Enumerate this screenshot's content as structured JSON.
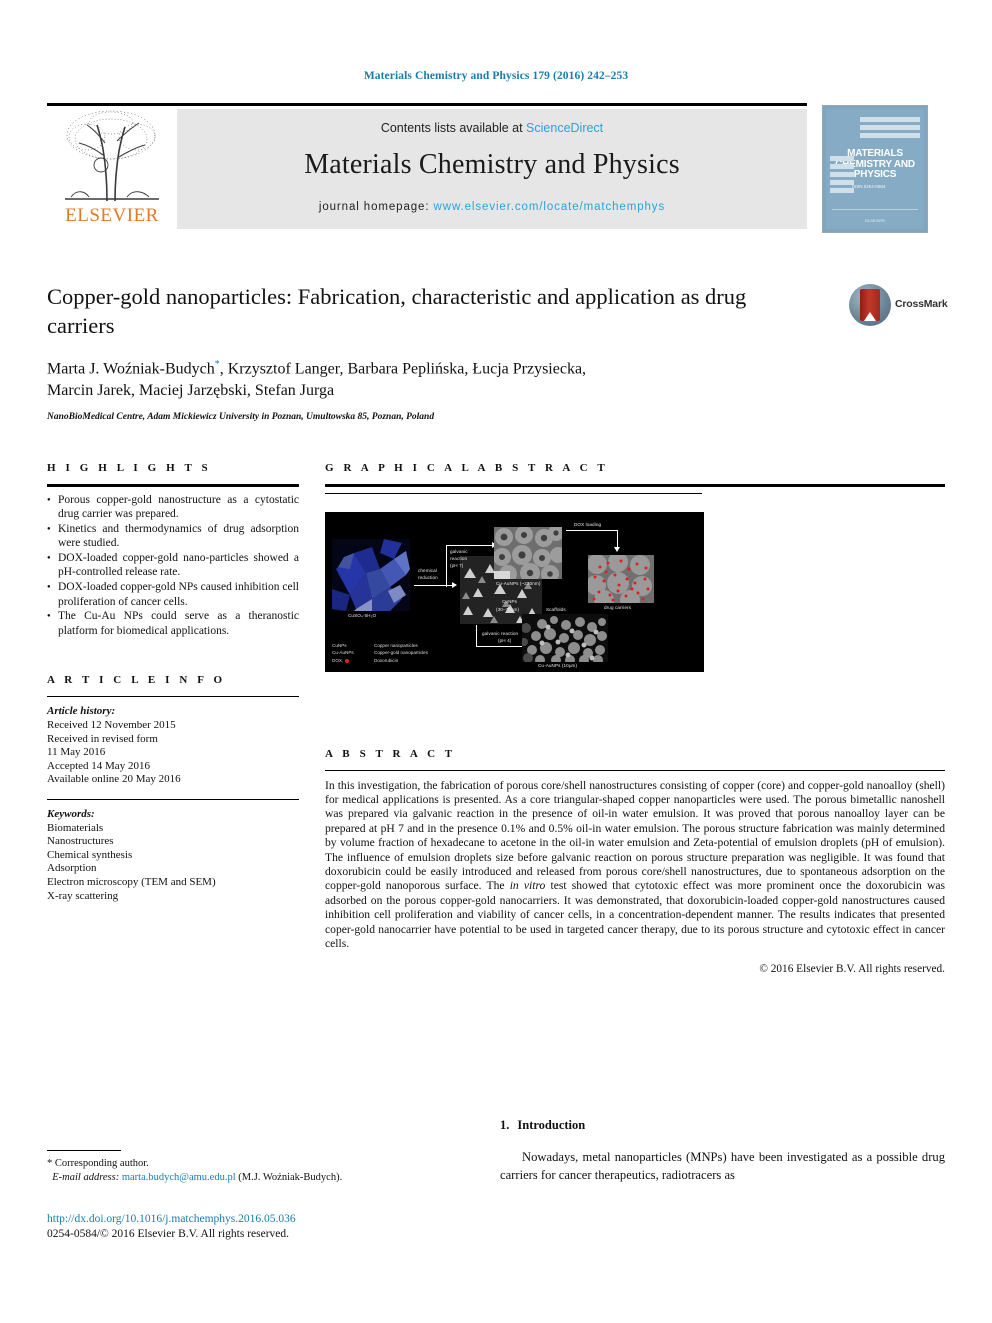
{
  "running_head": "Materials Chemistry and Physics 179 (2016) 242–253",
  "masthead": {
    "contents_prefix": "Contents lists available at ",
    "sciencedirect": "ScienceDirect",
    "journal_title": "Materials Chemistry and Physics",
    "homepage_prefix": "journal homepage: ",
    "homepage_url": "www.elsevier.com/locate/matchemphys",
    "publisher": "ELSEVIER",
    "publisher_color": "#e87722",
    "link_color": "#2aa3d6",
    "cover": {
      "title_line1": "MATERIALS",
      "title_line2": "CHEMISTRY AND",
      "title_line3": "PHYSICS",
      "sub": "ISSN 0254-0584",
      "footer": "ELSEVIER"
    }
  },
  "article": {
    "title": "Copper-gold nanoparticles: Fabrication, characteristic and application as drug carriers",
    "authors_line1": "Marta J. Woźniak-Budych",
    "authors_star": "*",
    "authors_line1b": ", Krzysztof Langer, Barbara Peplińska, Łucja Przysiecka,",
    "authors_line2": "Marcin Jarek, Maciej Jarzębski, Stefan Jurga",
    "affiliation": "NanoBioMedical Centre, Adam Mickiewicz University in Poznan, Umultowska 85, Poznan, Poland",
    "crossmark_label": "CrossMark"
  },
  "highlights": {
    "heading": "H I G H L I G H T S",
    "items": [
      "Porous copper-gold nanostructure as a cytostatic drug carrier was prepared.",
      "Kinetics and thermodynamics of drug adsorption were studied.",
      "DOX-loaded copper-gold nano-particles showed a pH-controlled release rate.",
      "DOX-loaded copper-gold NPs caused inhibition cell proliferation of cancer cells.",
      "The Cu-Au NPs could serve as a theranostic platform for biomedical applications."
    ]
  },
  "article_info": {
    "heading": "A R T I C L E  I N F O",
    "history_label": "Article history:",
    "history": [
      "Received 12 November 2015",
      "Received in revised form",
      "11 May 2016",
      "Accepted 14 May 2016",
      "Available online 20 May 2016"
    ],
    "keywords_label": "Keywords:",
    "keywords": [
      "Biomaterials",
      "Nanostructures",
      "Chemical synthesis",
      "Adsorption",
      "Electron microscopy (TEM and SEM)",
      "X-ray scattering"
    ]
  },
  "graphical_abstract": {
    "heading": "G R A P H I C A L  A B S T R A C T",
    "captions": {
      "precursor": "CuSO₄·5H₂O",
      "chemical_reduction_l1": "chemical",
      "chemical_reduction_l2": "reduction",
      "cunps_l1": "CuNPs",
      "cunps_l2": "(30–70nm)",
      "galvanic_ph7_l1": "galvanic",
      "galvanic_ph7_l2": "reaction",
      "galvanic_ph7_l3": "(pH 7)",
      "cuaunps_230": "Cu-AuNPs (~230nm)",
      "dox_loading": "DOX loading",
      "drug_carriers": "drug carriers",
      "scaffolds": "Scaffolds",
      "galvanic_ph4_l1": "galvanic reaction",
      "galvanic_ph4_l2": "(pH 4)",
      "cuaunps_10um": "Cu-AuNPs (10μm)"
    },
    "legend": [
      {
        "key": "CuNPs",
        "value": "Copper nanoparticles"
      },
      {
        "key": "Cu-AuNPs",
        "value": "Copper-gold nanoparticles"
      },
      {
        "key": "DOX,",
        "value": "Doxorubicin"
      }
    ]
  },
  "abstract": {
    "heading": "A B S T R A C T",
    "part1": "In this investigation, the fabrication of porous core/shell nanostructures consisting of copper (core) and copper-gold nanoalloy (shell) for medical applications is presented. As a core triangular-shaped copper nanoparticles were used. The porous bimetallic nanoshell was prepared via galvanic reaction in the presence of oil-in water emulsion. It was proved that porous nanoalloy layer can be prepared at pH 7 and in the presence 0.1% and 0.5% oil-in water emulsion. The porous structure fabrication was mainly determined by volume fraction of hexadecane to acetone in the oil-in water emulsion and Zeta-potential of emulsion droplets (pH of emulsion). The influence of emulsion droplets size before galvanic reaction on porous structure preparation was negligible. It was found that doxorubicin could be easily introduced and released from porous core/shell nanostructures, due to spontaneous adsorption on the copper-gold nanoporous surface. The ",
    "italic": "in vitro",
    "part2": " test showed that cytotoxic effect was more prominent once the doxorubicin was adsorbed on the porous copper-gold nanocarriers. It was demonstrated, that doxorubicin-loaded copper-gold nanostructures caused inhibition cell proliferation and viability of cancer cells, in a concentration-dependent manner. The results indicates that presented coper-gold nanocarrier have potential to be used in targeted cancer therapy, due to its porous structure and cytotoxic effect in cancer cells.",
    "copyright": "© 2016 Elsevier B.V. All rights reserved."
  },
  "footnote": {
    "corresponding": "* Corresponding author.",
    "email_label": "E-mail address:",
    "email": "marta.budych@amu.edu.pl",
    "email_owner": "(M.J. Woźniak-Budych)."
  },
  "doi": {
    "url": "http://dx.doi.org/10.1016/j.matchemphys.2016.05.036",
    "issn": "0254-0584/© 2016 Elsevier B.V. All rights reserved."
  },
  "introduction": {
    "number": "1.",
    "title": "Introduction",
    "body": "Nowadays, metal nanoparticles (MNPs) have been investigated as a possible drug carriers for cancer therapeutics, radiotracers as"
  }
}
